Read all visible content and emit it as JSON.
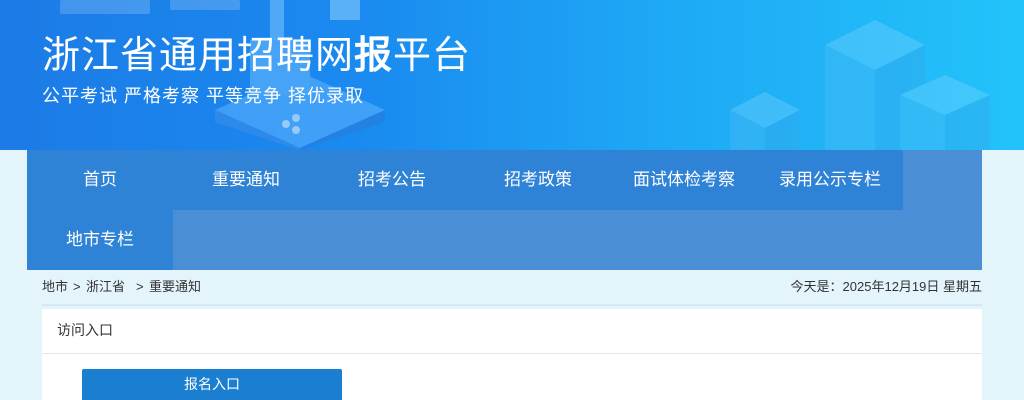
{
  "banner": {
    "title_pre": "浙江省通用招聘网",
    "title_bold": "报",
    "title_post": "平台",
    "slogan": "公平考试 严格考察 平等竞争 择优录取"
  },
  "nav": {
    "items": [
      {
        "label": "首页"
      },
      {
        "label": "重要通知"
      },
      {
        "label": "招考公告"
      },
      {
        "label": "招考政策"
      },
      {
        "label": "面试体检考察"
      },
      {
        "label": "录用公示专栏"
      },
      {
        "label": "地市专栏"
      }
    ]
  },
  "breadcrumb": {
    "items": [
      "地市",
      "浙江省",
      "重要通知"
    ],
    "separator": ">",
    "date_text": "今天是：2025年12月19日 星期五"
  },
  "panel": {
    "title": "访问入口",
    "entry_button": "报名入口"
  },
  "colors": {
    "banner_start": "#1c7be6",
    "banner_end": "#22c3fa",
    "nav_item": "#2f83d6",
    "nav_bg": "#4a8fd6",
    "button": "#1b7fd1",
    "page_bg": "#e4f4fb"
  }
}
